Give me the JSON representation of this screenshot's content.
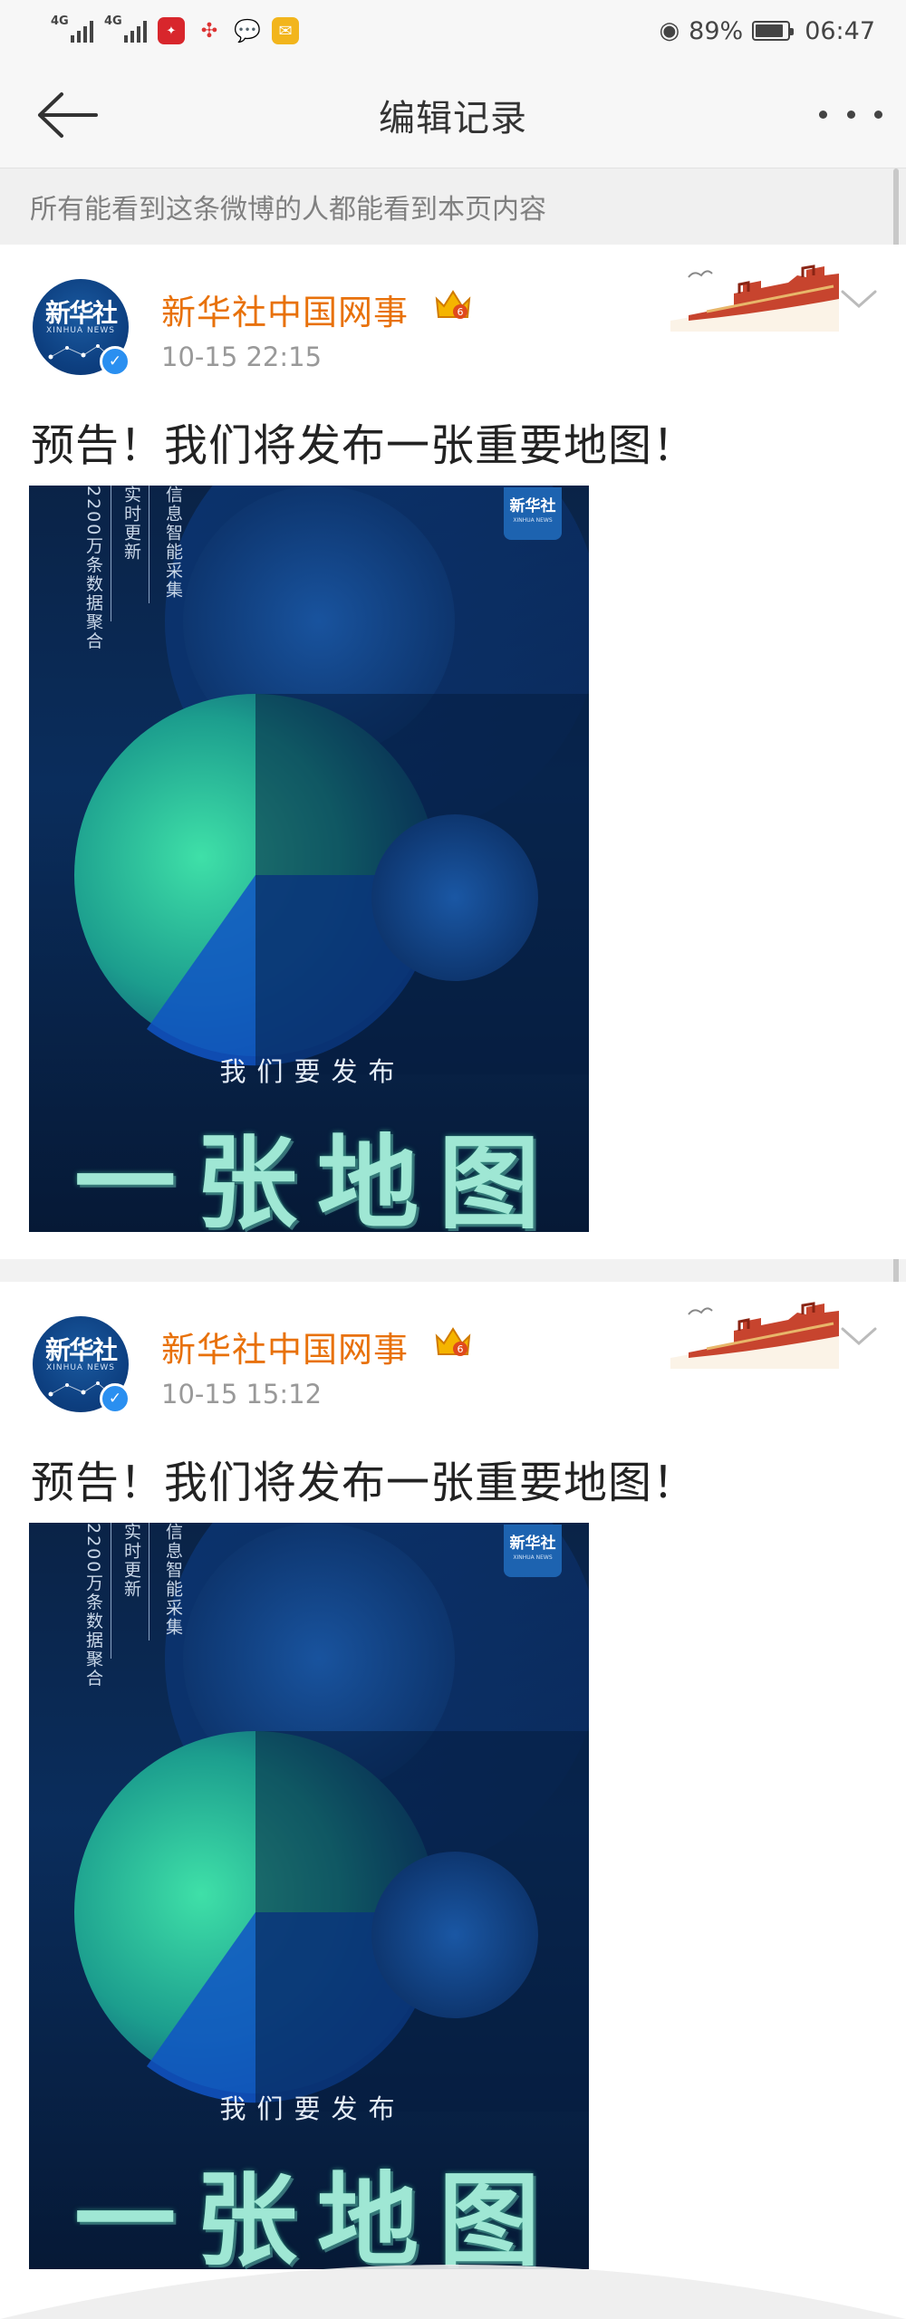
{
  "status_bar": {
    "network1": "4G",
    "network2": "4G",
    "battery": "89%",
    "battery_level": 0.89,
    "time": "06:47"
  },
  "nav": {
    "title": "编辑记录",
    "back_icon": "back-arrow-icon",
    "more_icon": "more-dots-icon"
  },
  "notice": {
    "text": "所有能看到这条微博的人都能看到本页内容"
  },
  "posts": [
    {
      "author": "新华社中国网事",
      "time": "10-15 22:15",
      "text": "预告！我们将发布一张重要地图！",
      "avatar_text": "新华社",
      "avatar_sub": "XINHUA NEWS",
      "poster": {
        "vertical_1": "2200万条数据聚合",
        "vertical_2": "实时更新",
        "vertical_3": "信息智能采集",
        "badge": "新华社",
        "caption_small": "我们要发布",
        "caption_big": "一张地图"
      }
    },
    {
      "author": "新华社中国网事",
      "time": "10-15 15:12",
      "text": "预告！我们将发布一张重要地图！",
      "avatar_text": "新华社",
      "avatar_sub": "XINHUA NEWS",
      "poster": {
        "vertical_1": "2200万条数据聚合",
        "vertical_2": "实时更新",
        "vertical_3": "信息智能采集",
        "badge": "新华社",
        "caption_small": "我们要发布",
        "caption_big": "一张地图"
      }
    }
  ],
  "colors": {
    "accent_name": "#e8710a",
    "verified": "#2a8ff0",
    "poster_bg": "#0a2347"
  }
}
